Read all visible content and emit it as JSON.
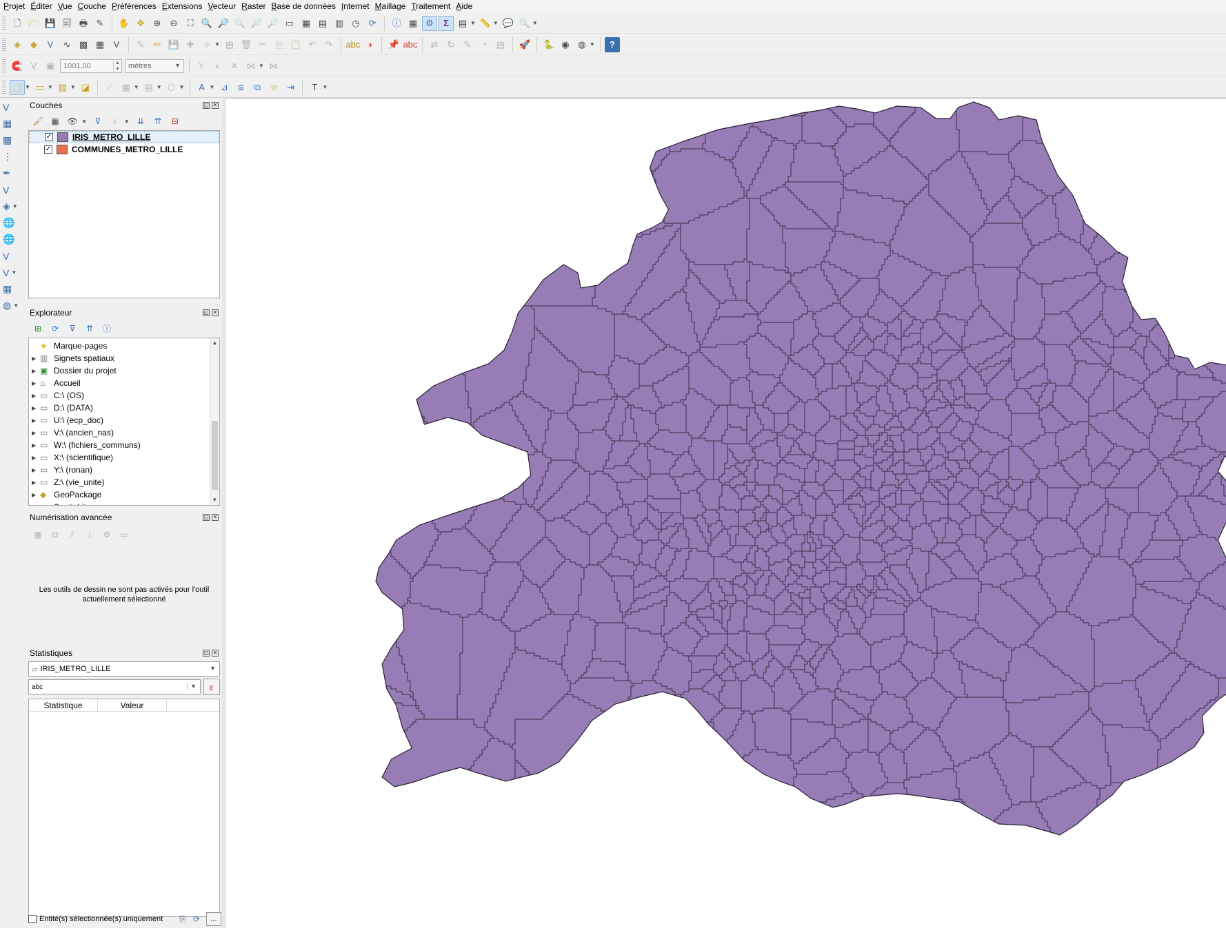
{
  "menu": [
    {
      "pre": "",
      "u": "P",
      "post": "rojet"
    },
    {
      "pre": "",
      "u": "É",
      "post": "diter"
    },
    {
      "pre": "",
      "u": "V",
      "post": "ue"
    },
    {
      "pre": "",
      "u": "C",
      "post": "ouche"
    },
    {
      "pre": "",
      "u": "P",
      "post": "références"
    },
    {
      "pre": "",
      "u": "E",
      "post": "xtensions"
    },
    {
      "pre": "",
      "u": "V",
      "post": "ecteur"
    },
    {
      "pre": "",
      "u": "R",
      "post": "aster"
    },
    {
      "pre": "",
      "u": "B",
      "post": "ase de données"
    },
    {
      "pre": "",
      "u": "I",
      "post": "nternet"
    },
    {
      "pre": "",
      "u": "M",
      "post": "aillage"
    },
    {
      "pre": "",
      "u": "T",
      "post": "raitement"
    },
    {
      "pre": "",
      "u": "A",
      "post": "ide"
    }
  ],
  "snapping": {
    "tolerance": "1001,00",
    "units": "mètres"
  },
  "panels": {
    "layers": {
      "title": "Couches",
      "items": [
        {
          "name": "IRIS_METRO_LILLE",
          "color": "#977cb6",
          "checked": "✓"
        },
        {
          "name": "COMMUNES_METRO_LILLE",
          "color": "#e8704f",
          "checked": "✓"
        }
      ]
    },
    "browser": {
      "title": "Explorateur",
      "items": [
        {
          "label": "Marque-pages",
          "icon": "star-icon",
          "exp": ""
        },
        {
          "label": "Signets spatiaux",
          "icon": "bookmark-icon",
          "exp": "▶"
        },
        {
          "label": "Dossier du projet",
          "icon": "project-folder-icon",
          "exp": "▶"
        },
        {
          "label": "Accueil",
          "icon": "home-icon",
          "exp": "▶"
        },
        {
          "label": "C:\\ (OS)",
          "icon": "folder-icon",
          "exp": "▶"
        },
        {
          "label": "D:\\ (DATA)",
          "icon": "folder-icon",
          "exp": "▶"
        },
        {
          "label": "U:\\ (ecp_doc)",
          "icon": "folder-icon",
          "exp": "▶"
        },
        {
          "label": "V:\\ (ancien_nas)",
          "icon": "folder-icon",
          "exp": "▶"
        },
        {
          "label": "W:\\ (fichiers_communs)",
          "icon": "folder-icon",
          "exp": "▶"
        },
        {
          "label": "X:\\ (scientifique)",
          "icon": "folder-icon",
          "exp": "▶"
        },
        {
          "label": "Y:\\ (ronan)",
          "icon": "folder-icon",
          "exp": "▶"
        },
        {
          "label": "Z:\\ (vie_unite)",
          "icon": "folder-icon",
          "exp": "▶"
        },
        {
          "label": "GeoPackage",
          "icon": "geopackage-icon",
          "exp": "▶"
        },
        {
          "label": "SpatiaLite",
          "icon": "spatialite-icon",
          "exp": "▶"
        }
      ]
    },
    "advanced": {
      "title": "Numérisation avancée",
      "message": "Les outils de dessin ne sont pas activés pour l'outil actuellement sélectionné"
    },
    "stats": {
      "title": "Statistiques",
      "layer": "IRIS_METRO_LILLE",
      "field": "abc",
      "epsilon": "ε",
      "col_stat": "Statistique",
      "col_value": "Valeur",
      "selected_only": "Entité(s) sélectionnée(s) uniquement",
      "more": "..."
    }
  },
  "map": {
    "fill": "#977cb6",
    "stroke": "#2a1f33"
  }
}
